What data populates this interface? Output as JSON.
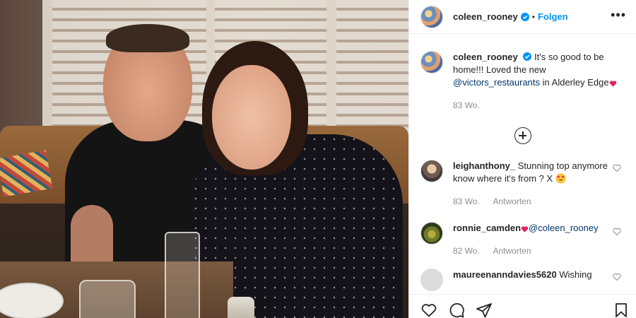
{
  "post": {
    "username": "coleen_rooney",
    "follow_label": "Folgen",
    "separator": "•",
    "more_label": "•••",
    "caption": {
      "text_part1": "It's so good to be home!!! Loved the new ",
      "mention": "@victors_restaurants",
      "text_part2": " in Alderley Edge",
      "emoji": "heart",
      "time": "83 Wo."
    },
    "load_more_icon": "plus-circle-icon"
  },
  "comments": [
    {
      "username": "leighanthony_",
      "text": "Stunning top anymore know where it's from ? X",
      "emoji": "heart-eyes",
      "time": "83 Wo.",
      "reply_label": "Antworten"
    },
    {
      "username": "ronnie_camden",
      "emoji": "heart",
      "mention": "@coleen_rooney",
      "time": "82 Wo.",
      "reply_label": "Antworten"
    },
    {
      "username": "maureenanndavies5620",
      "text": "Wishing"
    }
  ],
  "actions": {
    "icons": [
      "heart-icon",
      "comment-icon",
      "share-icon",
      "bookmark-icon"
    ]
  },
  "colors": {
    "accent": "#0095f6",
    "link": "#00376b",
    "muted": "#8e8e8e",
    "text": "#262626"
  }
}
